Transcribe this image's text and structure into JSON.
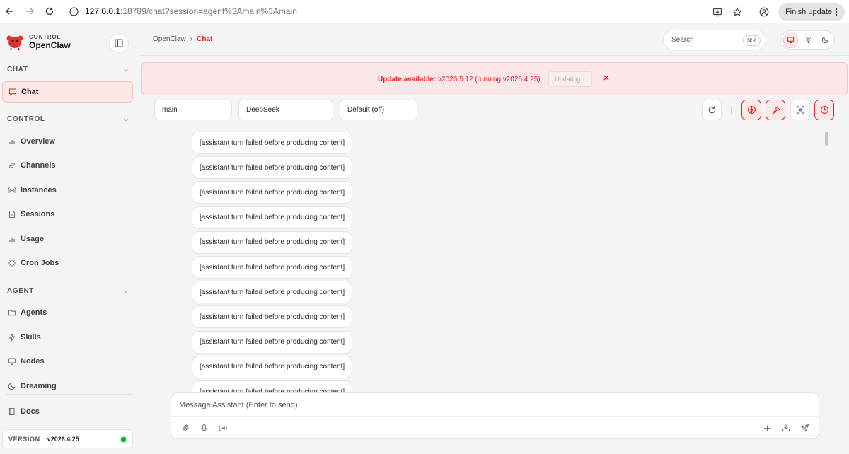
{
  "browser": {
    "url_host": "127.0.0.1",
    "url_path": ":18789/chat?session=agent%3Amain%3Amain",
    "finish_update_label": "Finish update"
  },
  "sidebar": {
    "brand_sub": "CONTROL",
    "brand_name": "OpenClaw",
    "sections": [
      {
        "label": "CHAT",
        "items": [
          {
            "label": "Chat",
            "icon": "chat-bubble-icon",
            "active": true
          }
        ]
      },
      {
        "label": "CONTROL",
        "items": [
          {
            "label": "Overview",
            "icon": "bar-chart-icon"
          },
          {
            "label": "Channels",
            "icon": "link-icon"
          },
          {
            "label": "Instances",
            "icon": "radio-icon"
          },
          {
            "label": "Sessions",
            "icon": "document-icon"
          },
          {
            "label": "Usage",
            "icon": "bar-chart-icon"
          },
          {
            "label": "Cron Jobs",
            "icon": "loader-icon"
          }
        ]
      },
      {
        "label": "AGENT",
        "items": [
          {
            "label": "Agents",
            "icon": "folder-icon"
          },
          {
            "label": "Skills",
            "icon": "lightning-icon"
          },
          {
            "label": "Nodes",
            "icon": "monitor-icon"
          },
          {
            "label": "Dreaming",
            "icon": "moon-icon"
          }
        ]
      }
    ],
    "docs_label": "Docs",
    "version_label": "VERSION",
    "version_value": "v2026.4.25",
    "status_color": "#16a34a"
  },
  "header": {
    "breadcrumb_root": "OpenClaw",
    "breadcrumb_sep": "›",
    "breadcrumb_current": "Chat",
    "search_placeholder": "Search",
    "search_shortcut": "⌘K"
  },
  "banner": {
    "title": "Update available:",
    "detail": " v2026.5.12 (running v2026.4.25).",
    "button_label": "Updating..."
  },
  "toolbar": {
    "session": "main",
    "model": "DeepSeek",
    "thinking": "Default (off)"
  },
  "messages": [
    "[assistant turn failed before producing content]",
    "[assistant turn failed before producing content]",
    "[assistant turn failed before producing content]",
    "[assistant turn failed before producing content]",
    "[assistant turn failed before producing content]",
    "[assistant turn failed before producing content]",
    "[assistant turn failed before producing content]",
    "[assistant turn failed before producing content]",
    "[assistant turn failed before producing content]",
    "[assistant turn failed before producing content]",
    "[assistant turn failed before producing content]"
  ],
  "composer": {
    "placeholder": "Message Assistant (Enter to send)"
  },
  "colors": {
    "accent": "#dc2626",
    "accent_bg": "#fde8e8"
  }
}
